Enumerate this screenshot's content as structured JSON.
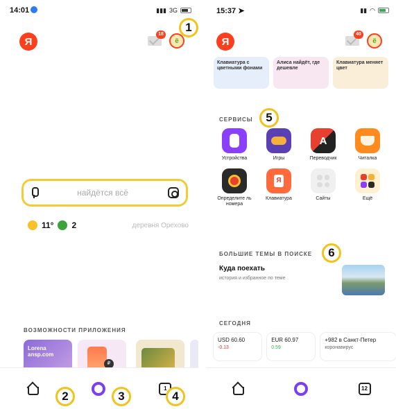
{
  "colors": {
    "yandex_red": "#fc3f1d",
    "alice_purple": "#7b3ff2",
    "search_border": "#f2cc34",
    "marker_yellow": "#f2c31a",
    "down_red": "#e03030",
    "up_green": "#2bb24c"
  },
  "left": {
    "status_time": "14:01",
    "status_network": "3G",
    "logo_letter": "Я",
    "mail_badge": "18",
    "search_placeholder": "найдётся всё",
    "weather_temp": "11°",
    "air_index": "2",
    "place": "деревня Орехово",
    "features_title": "ВОЗМОЖНОСТИ ПРИЛОЖЕНИЯ",
    "feature_cards": [
      {
        "label": "Lorena ansp.com"
      },
      {
        "label": ""
      },
      {
        "label": ""
      }
    ],
    "markers": [
      "1",
      "2",
      "3",
      "4"
    ],
    "tabs_count": "1"
  },
  "right": {
    "status_time": "15:37",
    "logo_letter": "Я",
    "mail_badge": "40",
    "hints": [
      {
        "text": "Клавиатура с цветными фонами"
      },
      {
        "text": "Алиса найдёт, где дешевле"
      },
      {
        "text": "Клавиатура меняет цвет"
      }
    ],
    "services_title": "СЕРВИСЫ",
    "services": [
      {
        "label": "Устройства",
        "icon": "devices-icon",
        "color": "#8a3ffc"
      },
      {
        "label": "Игры",
        "icon": "gamepad-icon",
        "color": "#5b3fb5"
      },
      {
        "label": "Переводчик",
        "icon": "translate-icon",
        "color": "#222222"
      },
      {
        "label": "Читалка",
        "icon": "book-icon",
        "color": "#ff8a1d"
      },
      {
        "label": "Определите ль номера",
        "icon": "phone-icon",
        "color": "#2a2a2a"
      },
      {
        "label": "Клавиатура",
        "icon": "keyboard-icon",
        "color": "#ff6a3d"
      },
      {
        "label": "Сайты",
        "icon": "sites-icon",
        "color": "#f0f0f0"
      },
      {
        "label": "Ещё",
        "icon": "more-icon",
        "color": "#fff0d0"
      }
    ],
    "topics_title": "БОЛЬШИЕ ТЕМЫ В ПОИСКЕ",
    "topic_title": "Куда поехать",
    "topic_subtitle": "история и избранное по теме",
    "today_title": "СЕГОДНЯ",
    "cards": [
      {
        "title": "USD 60.60",
        "delta": "-0.13",
        "delta_color": "#e03030"
      },
      {
        "title": "EUR 60.97",
        "delta": "0.59",
        "delta_color": "#2bb24c"
      },
      {
        "title": "+982 в Санкт-Петер",
        "delta": "коронавирус",
        "delta_color": "#666666"
      }
    ],
    "markers": [
      "5",
      "6"
    ],
    "tabs_count": "12"
  }
}
